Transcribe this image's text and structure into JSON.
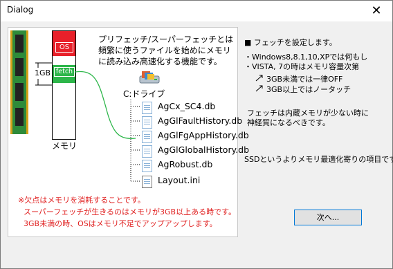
{
  "window": {
    "title": "Dialog",
    "close_glyph": "✕"
  },
  "diagram": {
    "description": "プリフェッチ/スーパーフェッチとは頻繁に使うファイルを始めにメモリに読み込み高速化する機能です。",
    "os_label": "OS",
    "fetch_label": "fetch",
    "size_label": "1GB",
    "memory_label": "メモリ",
    "drive_label": "C:ドライブ",
    "files": [
      "AgCx_SC4.db",
      "AgGlFaultHistory.db",
      "AgGlFgAppHistory.db",
      "AgGlGlobalHistory.db",
      "AgRobust.db",
      "Layout.ini"
    ],
    "note": [
      "※欠点はメモリを消耗することです。",
      "スーパーフェッチが生きるのはメモリが3GB以上ある時です。",
      "3GB未満の時、OSはメモリ不足でアップアップします。"
    ],
    "colors": {
      "os": "#e8202a",
      "fetch": "#2db64a",
      "note": "#e02020"
    }
  },
  "info": {
    "heading": "■ フェッチを設定します。",
    "line1": "・Windows8,8.1,10,XPでは何もし",
    "line2": "・VISTA, 7の時はメモリ容量次第",
    "opt1": "3GB未満では一律OFF",
    "opt2": "3GB以上ではノータッチ",
    "para1": "フェッチは内蔵メモリが少ない時に",
    "para2": "神経質になるべきです。",
    "para3": "SSDというよりメモリ最適化寄りの項目です。"
  },
  "buttons": {
    "next": "次へ..."
  }
}
